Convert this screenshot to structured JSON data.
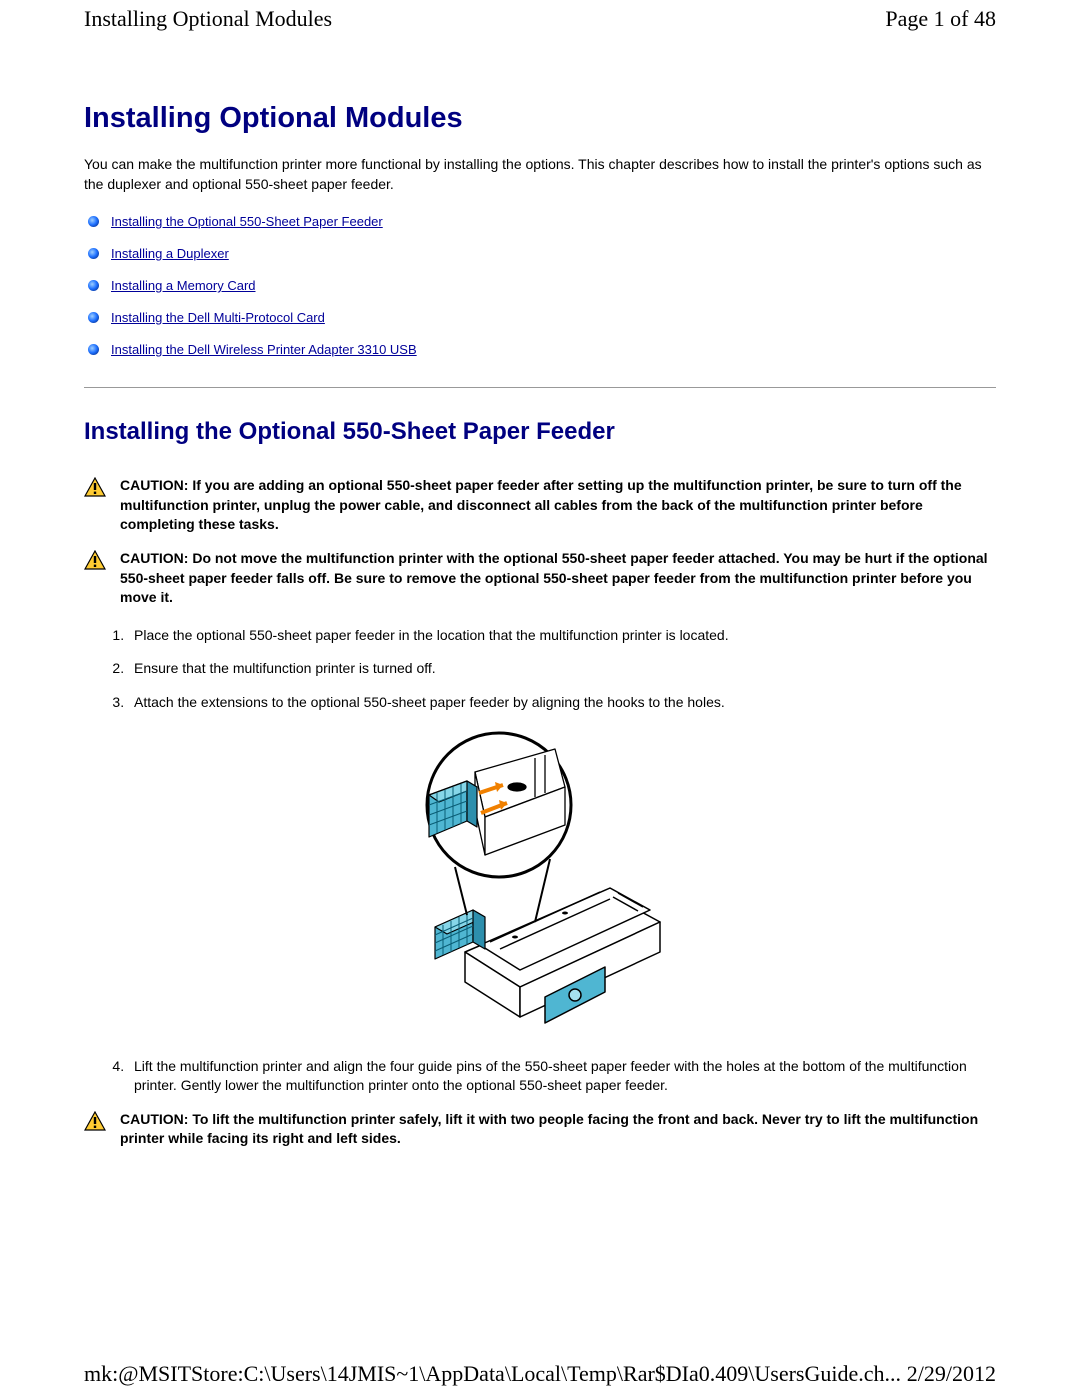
{
  "header": {
    "title": "Installing Optional Modules",
    "page_indicator": "Page 1 of 48"
  },
  "main": {
    "title": "Installing Optional Modules",
    "intro": "You can make the multifunction printer more functional by installing the options. This chapter describes how to install the printer's options such as the duplexer and optional 550-sheet paper feeder.",
    "toc": [
      "Installing the Optional 550-Sheet Paper Feeder",
      "Installing a Duplexer",
      "Installing a Memory Card",
      "Installing the Dell Multi-Protocol Card",
      "Installing the Dell Wireless Printer Adapter 3310 USB"
    ]
  },
  "section": {
    "title": "Installing the Optional 550-Sheet Paper Feeder",
    "caution_label": "CAUTION:",
    "cautions": [
      "If you are adding an optional 550-sheet paper feeder after setting up the multifunction printer, be sure to turn off the multifunction printer, unplug the power cable, and disconnect all cables from the back of the multifunction printer before completing these tasks.",
      "Do not move the multifunction printer with the optional 550-sheet paper feeder attached. You may be hurt if the optional 550-sheet paper feeder falls off. Be sure to remove the optional 550-sheet paper feeder from the multifunction printer before you move it."
    ],
    "steps": [
      "Place the optional 550-sheet paper feeder in the location that the multifunction printer is located.",
      "Ensure that the multifunction printer is turned off.",
      "Attach the extensions to the optional 550-sheet paper feeder by aligning the hooks to the holes.",
      "Lift the multifunction printer and align the four guide pins of the 550-sheet paper feeder with the holes at the bottom of the multifunction printer. Gently lower the multifunction printer onto the optional 550-sheet paper feeder."
    ],
    "caution_bottom": "To lift the multifunction printer safely, lift it with two people facing the front and back. Never try to lift the multifunction printer while facing its right and left sides."
  },
  "footer": {
    "path": "mk:@MSITStore:C:\\Users\\14JMIS~1\\AppData\\Local\\Temp\\Rar$DIa0.409\\UsersGuide.ch...",
    "date": "2/29/2012"
  },
  "colors": {
    "heading": "#000080",
    "link": "#000099"
  }
}
